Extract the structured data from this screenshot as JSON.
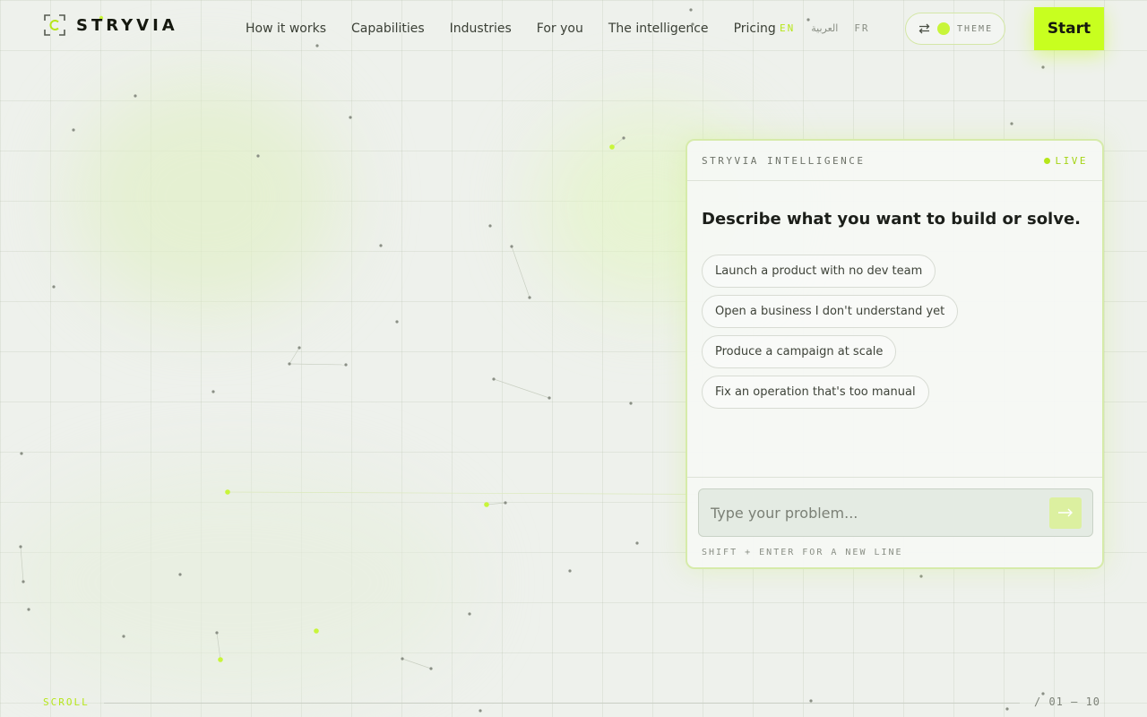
{
  "brand": {
    "name": "STRYVIA",
    "logo_icon": "bracket-logo-icon"
  },
  "nav": {
    "items": [
      {
        "label": "How it works"
      },
      {
        "label": "Capabilities"
      },
      {
        "label": "Industries"
      },
      {
        "label": "For you"
      },
      {
        "label": "The intelligence"
      },
      {
        "label": "Pricing"
      }
    ]
  },
  "languages": {
    "items": [
      {
        "code": "EN",
        "active": true
      },
      {
        "code": "العربية",
        "active": false
      },
      {
        "code": "FR",
        "active": false
      }
    ]
  },
  "theme": {
    "label": "THEME",
    "icon": "sliders-icon"
  },
  "start_button": {
    "label": "Start"
  },
  "panel": {
    "title": "STRYVIA INTELLIGENCE",
    "status": "LIVE",
    "heading": "Describe what you want to build or solve.",
    "suggestions": [
      {
        "label": "Launch a product with no dev team"
      },
      {
        "label": "Open a business I don't understand yet"
      },
      {
        "label": "Produce a campaign at scale"
      },
      {
        "label": "Fix an operation that's too manual"
      }
    ],
    "input": {
      "placeholder": "Type your problem...",
      "value": ""
    },
    "send_icon": "arrow-right-icon",
    "hint": "SHIFT + ENTER FOR A NEW LINE"
  },
  "scroll": {
    "label": "SCROLL"
  },
  "pager": {
    "text": "/ 01 — 10"
  },
  "colors": {
    "accent": "#c8ff1f",
    "accent_text": "#b6e619",
    "background": "#eef1ec",
    "text": "#1c1f1a"
  }
}
